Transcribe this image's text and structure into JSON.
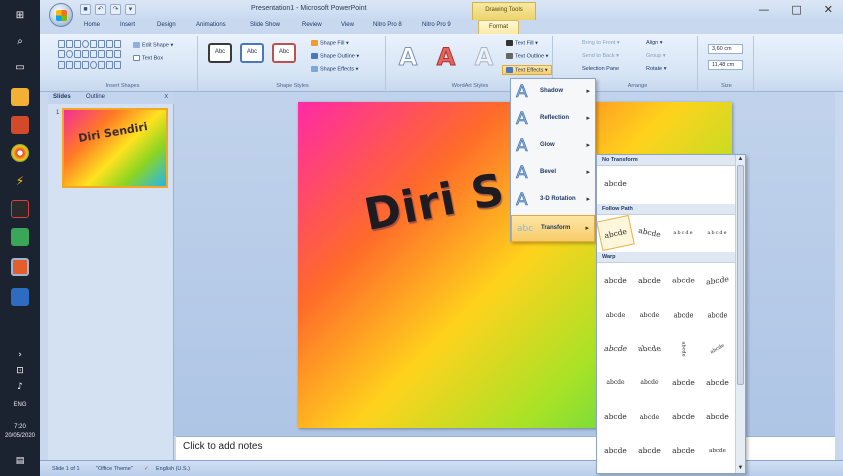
{
  "taskbar": {
    "tray_lang": "ENG",
    "time": "7:20",
    "date": "20/05/2020"
  },
  "titlebar": {
    "title": "Presentation1 - Microsoft PowerPoint",
    "context_group": "Drawing Tools",
    "window_controls": [
      "—",
      "□",
      "✕"
    ]
  },
  "tabs": [
    "Home",
    "Insert",
    "Design",
    "Animations",
    "Slide Show",
    "Review",
    "View",
    "Nitro Pro 8",
    "Nitro Pro 9",
    "Format"
  ],
  "ribbon": {
    "insert_shapes": {
      "label": "Insert Shapes",
      "edit_shape": "Edit Shape",
      "text_box": "Text Box"
    },
    "shape_styles": {
      "label": "Shape Styles",
      "style_text": "Abc",
      "fill": "Shape Fill",
      "outline": "Shape Outline",
      "effects": "Shape Effects"
    },
    "wordart_styles": {
      "label": "WordArt Styles",
      "glyph": "A",
      "text_fill": "Text Fill",
      "text_outline": "Text Outline",
      "text_effects": "Text Effects"
    },
    "arrange": {
      "label": "Arrange",
      "bring_front": "Bring to Front",
      "send_back": "Send to Back",
      "selection_pane": "Selection Pane",
      "align": "Align",
      "group": "Group",
      "rotate": "Rotate"
    },
    "size": {
      "label": "Size",
      "height": "3,60 cm",
      "width": "11,48 cm"
    }
  },
  "left_pane": {
    "tabs": [
      "Slides",
      "Outline"
    ],
    "close": "x",
    "slide_number": "1",
    "thumbnail_text": "Diri Sendiri"
  },
  "slide": {
    "wordart_text": "Diri S"
  },
  "notes": {
    "placeholder": "Click to add notes"
  },
  "text_effects_menu": [
    {
      "label": "Shadow",
      "glyph": "A"
    },
    {
      "label": "Reflection",
      "glyph": "A"
    },
    {
      "label": "Glow",
      "glyph": "A"
    },
    {
      "label": "Bevel",
      "glyph": "A"
    },
    {
      "label": "3-D Rotation",
      "glyph": "A"
    },
    {
      "label": "Transform",
      "glyph": "abc"
    }
  ],
  "transform_gallery": {
    "no_transform": {
      "label": "No Transform",
      "items": [
        "abcde"
      ]
    },
    "follow_path": {
      "label": "Follow Path",
      "items": [
        "abcde",
        "abcde",
        "abcde",
        "abcde"
      ]
    },
    "warp": {
      "label": "Warp",
      "items": [
        "abcde",
        "abcde",
        "abcde",
        "abcde",
        "abcde",
        "abcde",
        "abcde",
        "abcde",
        "abcde",
        "abcde",
        "abcde",
        "abcde",
        "abcde",
        "abcde",
        "abcde",
        "abcde",
        "abcde",
        "abcde",
        "abcde",
        "abcde",
        "abcde",
        "abcde",
        "abcde",
        "abcde"
      ]
    },
    "scroll_up": "▲",
    "scroll_down": "▼"
  },
  "statusbar": {
    "slide_info": "Slide 1 of 1",
    "theme": "\"Office Theme\"",
    "language": "English (U.S.)"
  },
  "colors": {
    "ribbon_bg": "#d6e4f5",
    "context_tab": "#edd36b",
    "taskbar": "#1c2330",
    "menu_highlight": "#f8cc6a"
  }
}
